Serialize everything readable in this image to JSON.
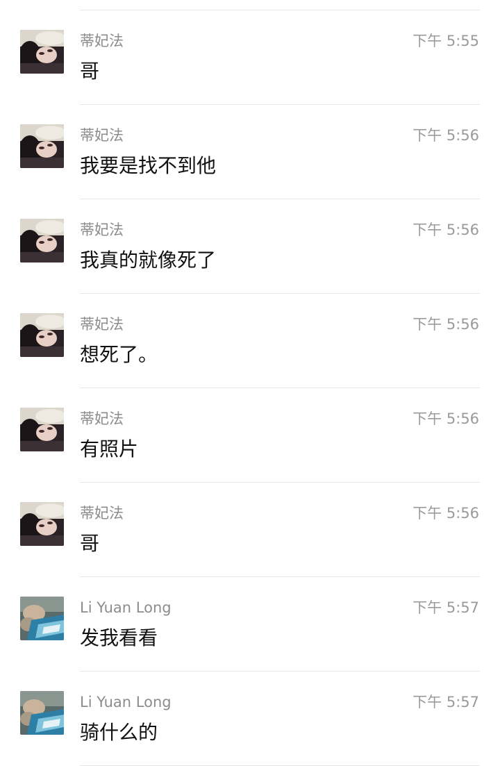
{
  "messages": [
    {
      "sender": "蒂妃法",
      "time": "下午 5:55",
      "text": "哥",
      "avatar": "woman-lying-avatar"
    },
    {
      "sender": "蒂妃法",
      "time": "下午 5:56",
      "text": "我要是找不到他",
      "avatar": "woman-lying-avatar"
    },
    {
      "sender": "蒂妃法",
      "time": "下午 5:56",
      "text": "我真的就像死了",
      "avatar": "woman-lying-avatar"
    },
    {
      "sender": "蒂妃法",
      "time": "下午 5:56",
      "text": "想死了。",
      "avatar": "woman-lying-avatar"
    },
    {
      "sender": "蒂妃法",
      "time": "下午 5:56",
      "text": "有照片",
      "avatar": "woman-lying-avatar"
    },
    {
      "sender": "蒂妃法",
      "time": "下午 5:56",
      "text": "哥",
      "avatar": "woman-lying-avatar"
    },
    {
      "sender": "Li Yuan Long",
      "time": "下午 5:57",
      "text": "发我看看",
      "avatar": "hand-photo-avatar"
    },
    {
      "sender": "Li Yuan Long",
      "time": "下午 5:57",
      "text": "骑什么的",
      "avatar": "hand-photo-avatar"
    }
  ],
  "colors": {
    "sender": "#8c8c8c",
    "time": "#9a9a9a",
    "text": "#111111",
    "divider": "#e6e6e6"
  }
}
